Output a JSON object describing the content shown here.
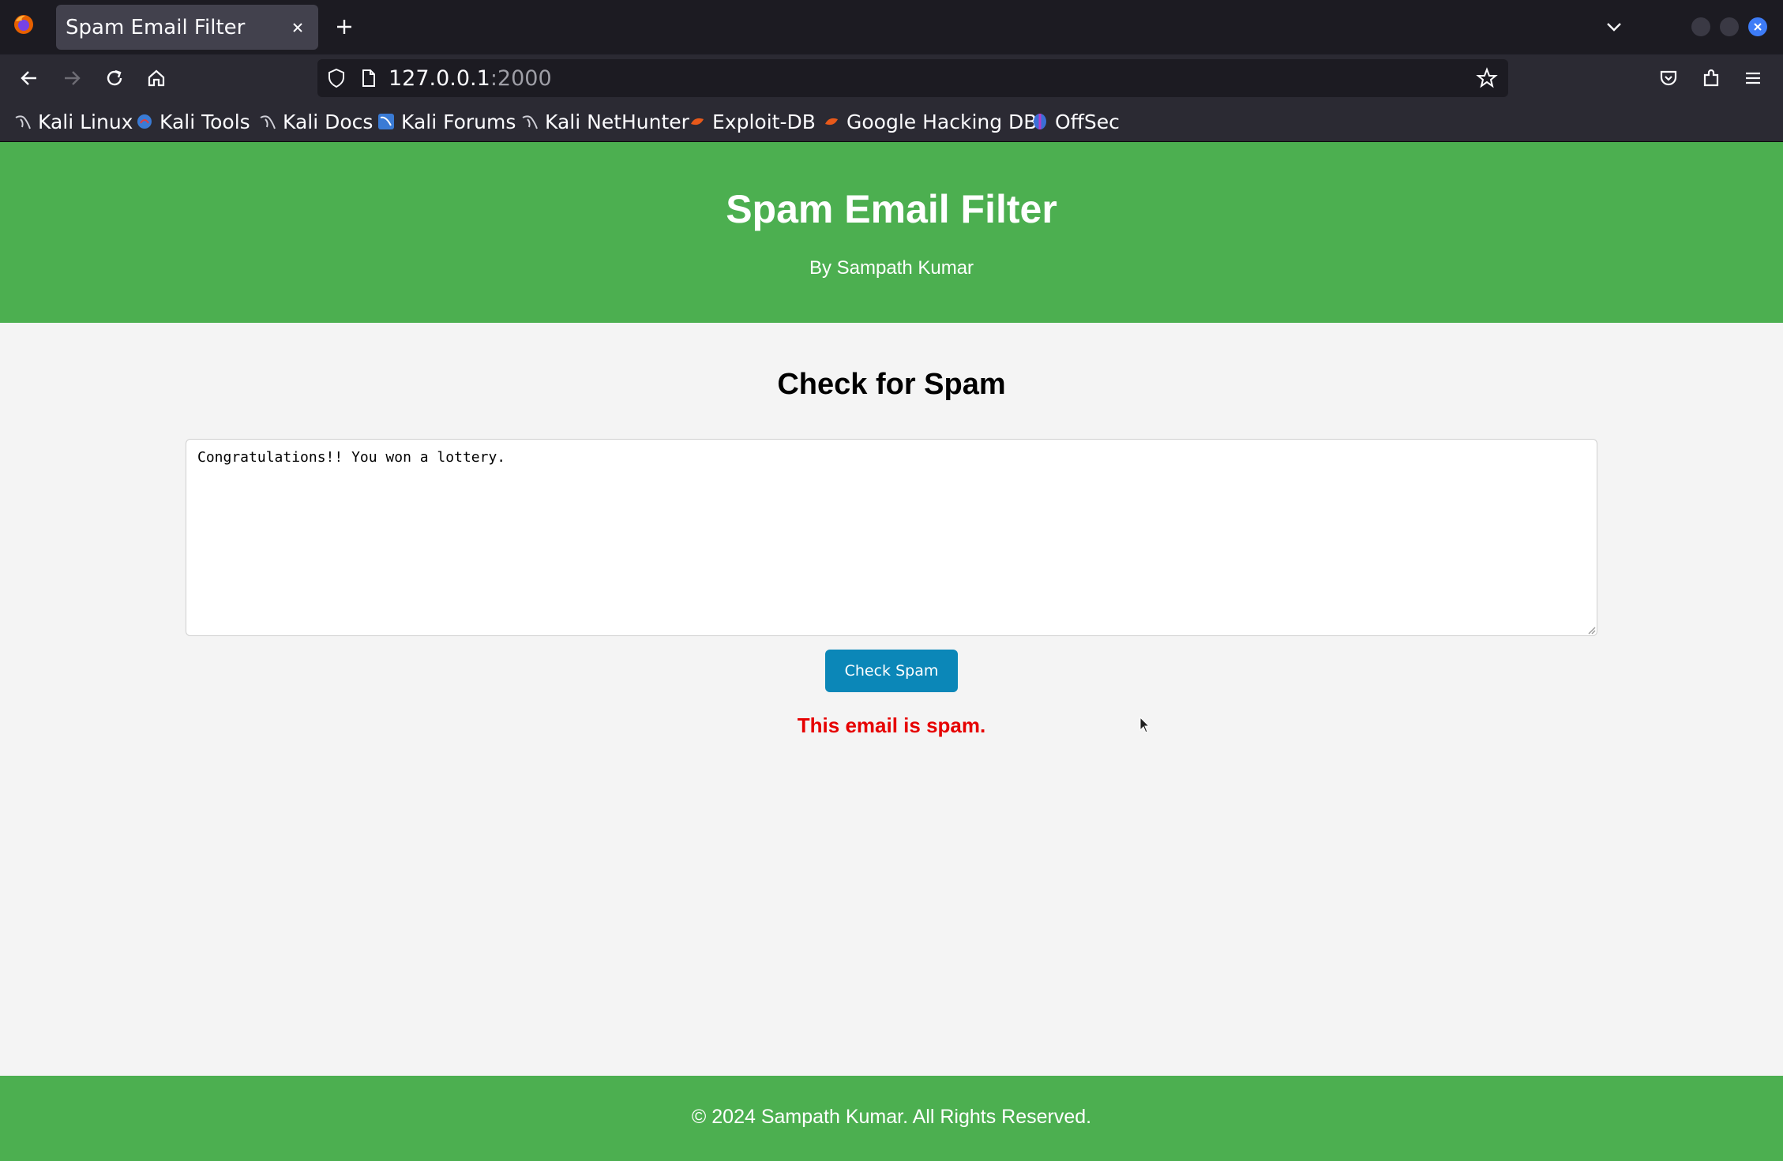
{
  "browser": {
    "tab_title": "Spam Email Filter",
    "url_host": "127.0.0.1",
    "url_port": ":2000",
    "bookmarks": [
      {
        "label": "Kali Linux",
        "icon": "kali-dragon-icon"
      },
      {
        "label": "Kali Tools",
        "icon": "kali-tools-icon"
      },
      {
        "label": "Kali Docs",
        "icon": "kali-dragon-icon"
      },
      {
        "label": "Kali Forums",
        "icon": "kali-forums-icon"
      },
      {
        "label": "Kali NetHunter",
        "icon": "kali-dragon-icon"
      },
      {
        "label": "Exploit-DB",
        "icon": "exploit-db-icon"
      },
      {
        "label": "Google Hacking DB",
        "icon": "exploit-db-icon"
      },
      {
        "label": "OffSec",
        "icon": "offsec-icon"
      }
    ]
  },
  "header": {
    "title": "Spam Email Filter",
    "byline": "By Sampath Kumar"
  },
  "main": {
    "section_title": "Check for Spam",
    "email_text": "Congratulations!! You won a lottery.",
    "button_label": "Check Spam",
    "result_text": "This email is spam."
  },
  "footer": {
    "copyright": "© 2024 Sampath Kumar. All Rights Reserved."
  },
  "colors": {
    "header_bg": "#4caf50",
    "button_bg": "#0b87b8",
    "result_text": "#e60000",
    "page_bg": "#f4f4f4"
  }
}
